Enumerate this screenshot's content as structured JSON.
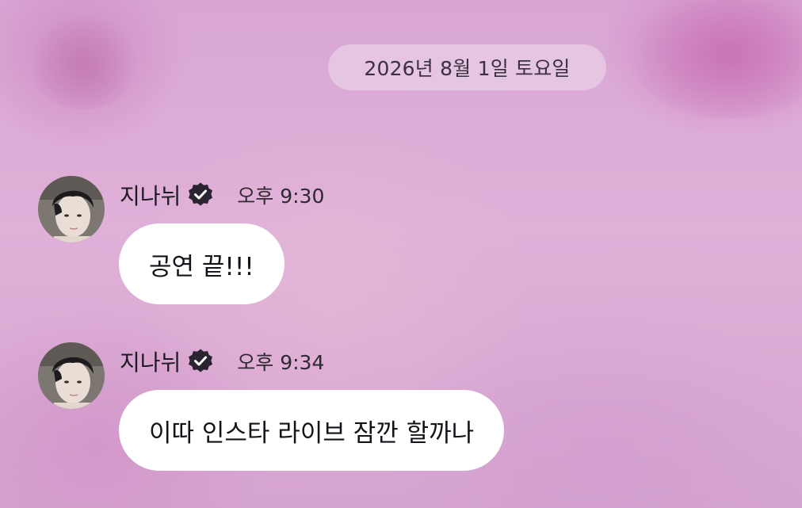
{
  "date_separator": "2026년 8월 1일 토요일",
  "messages": [
    {
      "sender": "지나뉘",
      "verified_icon": "verified-badge-icon",
      "time": "오후 9:30",
      "text": "공연 끝!!!"
    },
    {
      "sender": "지나뉘",
      "verified_icon": "verified-badge-icon",
      "time": "오후 9:34",
      "text": "이따 인스타 라이브 잠깐 할까나"
    }
  ],
  "colors": {
    "background": "#dcaed8",
    "bubble": "#ffffff",
    "date_pill": "#ecd6ea",
    "text": "#1f1a22",
    "badge": "#2a2330"
  }
}
